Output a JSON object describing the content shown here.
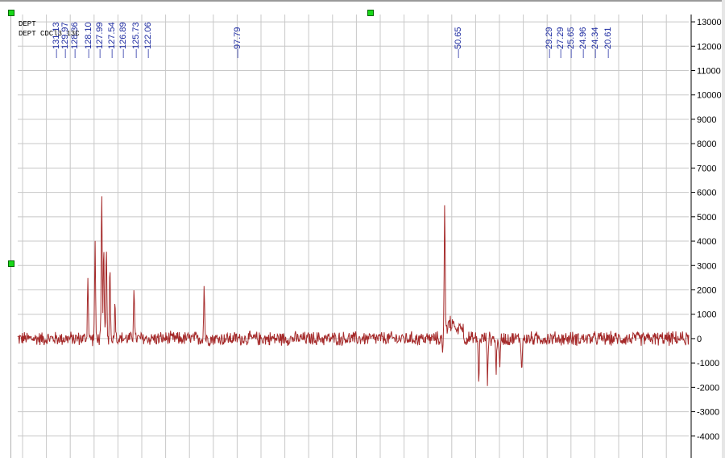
{
  "header_lines": [
    "DEPT",
    "DEPT CDCl3 13C"
  ],
  "colors": {
    "spectrum": "#a52a2a",
    "peak_labels": "#1c2aa0",
    "grid": "#c8c8c8",
    "axis_text": "#000000",
    "handle": "#18d818"
  },
  "chart_data": {
    "type": "line",
    "x_axis": {
      "direction": "decreasing",
      "xlim": [
        134.0,
        3.0
      ]
    },
    "y_axis": {
      "ylim": [
        -4900,
        13300
      ],
      "tick_values": [
        13000,
        12000,
        11000,
        10000,
        9000,
        8000,
        7000,
        6000,
        5000,
        4000,
        3000,
        2000,
        1000,
        0,
        -1000,
        -2000,
        -3000,
        -4000
      ],
      "tick_labels": [
        "13000",
        "12000",
        "11000",
        "10000",
        "9000",
        "8000",
        "7000",
        "6000",
        "5000",
        "4000",
        "3000",
        "2000",
        "1000",
        "0",
        "-1000",
        "-2000",
        "-3000",
        "-4000"
      ]
    },
    "grid": true,
    "baseline_noise": 280,
    "peak_labels": [
      "131.13",
      "129.97",
      "128.36",
      "128.10",
      "127.99",
      "127.54",
      "126.89",
      "125.73",
      "122.06",
      "97.79",
      "50.65",
      "29.29",
      "27.29",
      "25.65",
      "24.96",
      "24.34",
      "20.61"
    ],
    "peaks": [
      {
        "x": 120.3,
        "y": 2600
      },
      {
        "x": 118.9,
        "y": 3800
      },
      {
        "x": 117.6,
        "y": 6000
      },
      {
        "x": 117.2,
        "y": 4000
      },
      {
        "x": 116.7,
        "y": 3700
      },
      {
        "x": 116.0,
        "y": 3100
      },
      {
        "x": 115.0,
        "y": 1600
      },
      {
        "x": 111.3,
        "y": 2300
      },
      {
        "x": 97.6,
        "y": 2200
      },
      {
        "x": 50.65,
        "y": 5200
      },
      {
        "x": 44.0,
        "y": -1900
      },
      {
        "x": 42.3,
        "y": -1700
      },
      {
        "x": 40.6,
        "y": -1500
      },
      {
        "x": 39.9,
        "y": -1400
      },
      {
        "x": 35.6,
        "y": -1500
      }
    ],
    "negative_peaks": [
      {
        "x": 51.0,
        "y": -900
      }
    ],
    "baseline_raise_region": {
      "from": 51.0,
      "to": 47.0,
      "offset": 600
    }
  }
}
